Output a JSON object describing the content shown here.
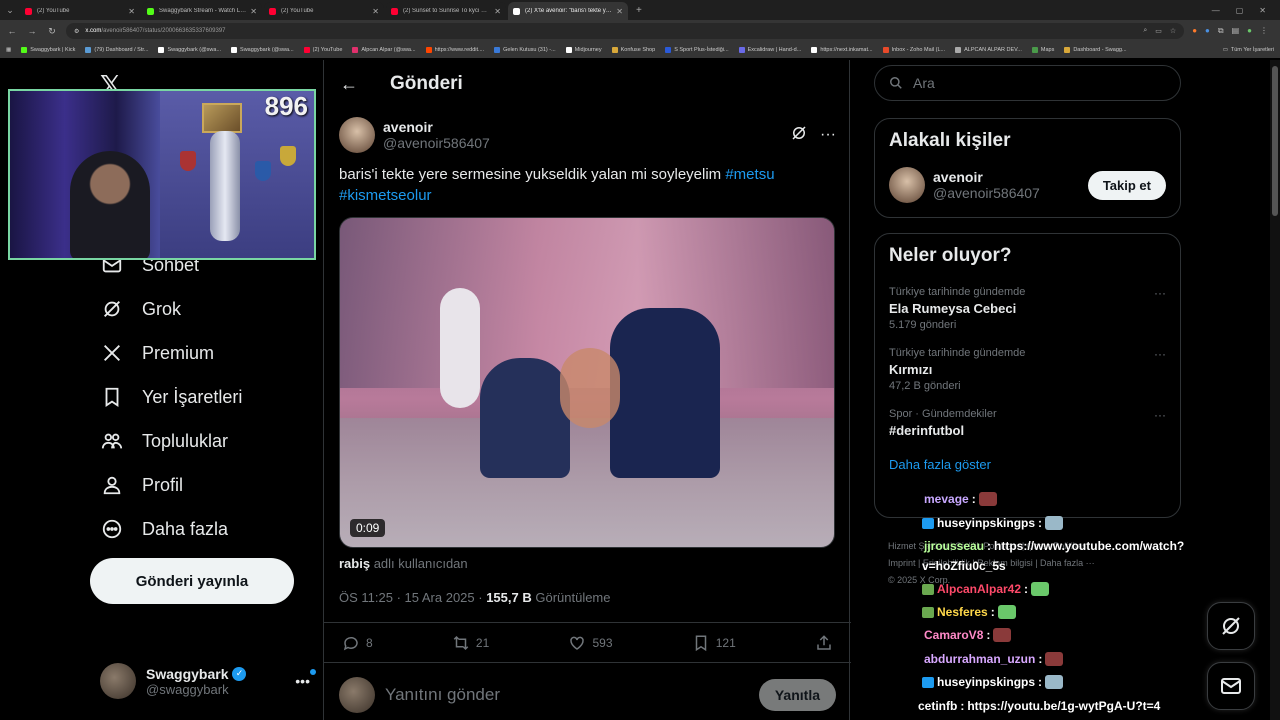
{
  "browser": {
    "tabs": [
      {
        "title": "(2) YouTube",
        "color": "#ff0033"
      },
      {
        "title": "Swaggybark Stream - Watch Li...",
        "color": "#53fc18"
      },
      {
        "title": "(2) YouTube",
        "color": "#ff0033"
      },
      {
        "title": "(2) Sunset to Sunrise To kyci Cit...",
        "color": "#ff0033"
      },
      {
        "title": "(2) X'te avenoir: \"baris'i tekte ye...",
        "color": "#ffffff"
      }
    ],
    "url_host": "x.com",
    "url_path": "/avenoir586407/status/2000663635337609397",
    "bookmarks": [
      "Swaggybark | Kick",
      "(79) Dashboard / Str...",
      "Swaggybark (@swa...",
      "Swaggybark (@swa...",
      "(2) YouTube",
      "Alpcan Alpar (@swa...",
      "https://www.reddit....",
      "Gelen Kutusu (31) -...",
      "Midjourney",
      "Konfuse Shop",
      "S Sport Plus-İstediği...",
      "Excalidraw | Hand-d...",
      "https://next.inkamat...",
      "Inbox - Zoho Mail (L...",
      "ALPCAN ALPAR DEV...",
      "Maps",
      "Dashboard - Swagg..."
    ],
    "bookmarks_all": "Tüm Yer İşaretleri"
  },
  "webcam": {
    "viewer_count": "896"
  },
  "nav": {
    "items": [
      {
        "label": "Sohbet",
        "icon": "mail-icon"
      },
      {
        "label": "Grok",
        "icon": "grok-icon"
      },
      {
        "label": "Premium",
        "icon": "x-icon"
      },
      {
        "label": "Yer İşaretleri",
        "icon": "bookmark-icon"
      },
      {
        "label": "Topluluklar",
        "icon": "communities-icon"
      },
      {
        "label": "Profil",
        "icon": "profile-icon"
      },
      {
        "label": "Daha fazla",
        "icon": "more-circle-icon"
      }
    ],
    "post_button": "Gönderi yayınla",
    "account": {
      "name": "Swaggybark",
      "handle": "@swaggybark"
    }
  },
  "main": {
    "title": "Gönderi",
    "tweet": {
      "name": "avenoir",
      "handle": "@avenoir586407",
      "text": "baris'i tekte yere sermesine yukseldik yalan mi soyleyelim ",
      "hashtag1": "#metsu",
      "hashtag2": "#kismetseolur",
      "video_duration": "0:09",
      "attribution_user": "rabiş",
      "attribution_suffix": " adlı kullanıcıdan",
      "time": "ÖS 11:25 · 15 Ara 2025 · ",
      "views": "155,7 B",
      "views_label": " Görüntüleme",
      "replies": "8",
      "reposts": "21",
      "likes": "593",
      "bookmarks": "121"
    },
    "reply_placeholder": "Yanıtını gönder",
    "reply_button": "Yanıtla"
  },
  "right": {
    "search_placeholder": "Ara",
    "related_title": "Alakalı kişiler",
    "related_person": {
      "name": "avenoir",
      "handle": "@avenoir586407",
      "follow": "Takip et"
    },
    "trends_title": "Neler oluyor?",
    "trends": [
      {
        "category": "Türkiye tarihinde gündemde",
        "name": "Ela Rumeysa Cebeci",
        "count": "5.179 gönderi"
      },
      {
        "category": "Türkiye tarihinde gündemde",
        "name": "Kırmızı",
        "count": "47,2 B gönderi"
      },
      {
        "category": "Spor · Gündemdekiler",
        "name": "#derinfutbol",
        "count": ""
      }
    ],
    "show_more": "Daha fazla göster",
    "footer": {
      "line1": "Hizmet Şartları   |   Gizlilik Politikası   |   Çerez Politikası",
      "line2": "Imprint   |   Erişilebilirlik   |   Reklam bilgisi   |   Daha fazla ···",
      "line3": "© 2025 X Corp."
    }
  },
  "chat": [
    {
      "user": "mevage",
      "msg": "",
      "color": "#c8a8ff",
      "badge": "",
      "emote": "#8a3a3a"
    },
    {
      "user": "huseyinpskingps",
      "msg": "",
      "color": "#ffffff",
      "badge": "#1d9bf0",
      "emote": "#9ab8c8"
    },
    {
      "user": "jjrousseau",
      "msg": "https://www.youtube.com/watch?",
      "color": "#b8ff9a",
      "badge": "",
      "emote": ""
    },
    {
      "user": "",
      "msg": "v=hoZfiu0c_5s",
      "color": "#ffffff",
      "badge": "",
      "emote": ""
    },
    {
      "user": "AlpcanAlpar42",
      "msg": "",
      "color": "#ff4a6a",
      "badge": "#6aa84f",
      "emote": "#6ac86a"
    },
    {
      "user": "Nesferes",
      "msg": "",
      "color": "#ffd84a",
      "badge": "#6aa84f",
      "emote": "#6ac86a"
    },
    {
      "user": "CamaroV8",
      "msg": "",
      "color": "#ff8ac8",
      "badge": "",
      "emote": "#8a3a3a"
    },
    {
      "user": "abdurrahman_uzun",
      "msg": "",
      "color": "#d8a8ff",
      "badge": "",
      "emote": "#8a3a3a"
    },
    {
      "user": "huseyinpskingps",
      "msg": "",
      "color": "#ffffff",
      "badge": "#1d9bf0",
      "emote": "#9ab8c8"
    },
    {
      "user": "cetinfb",
      "msg": "https://youtu.be/1g-wytPgA-U?t=4",
      "color": "#ffffff",
      "badge": "",
      "emote": ""
    }
  ]
}
